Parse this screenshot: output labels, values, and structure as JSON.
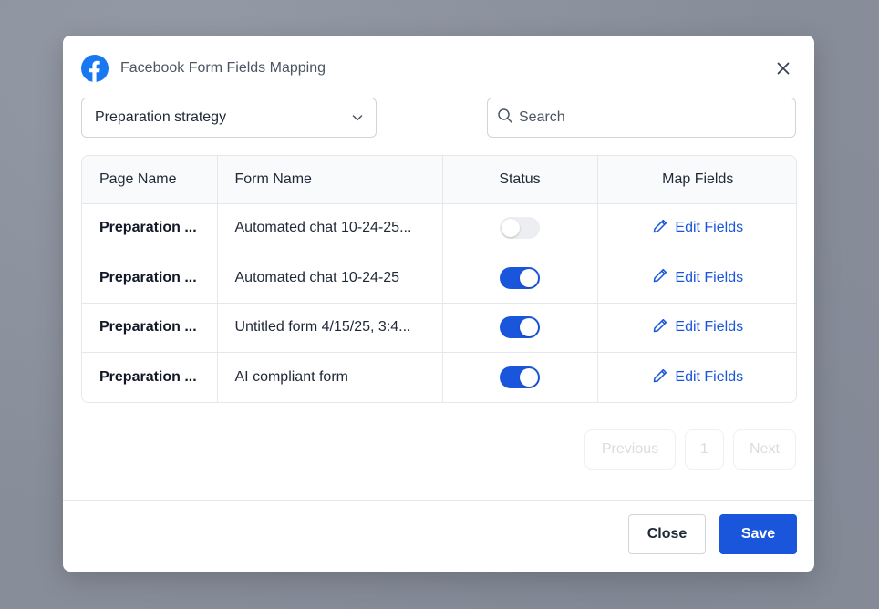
{
  "modal": {
    "title": "Facebook Form Fields Mapping",
    "icon": "facebook-icon",
    "close_icon": "close-icon"
  },
  "filter": {
    "page_select_value": "Preparation strategy",
    "search_placeholder": "Search"
  },
  "table": {
    "headers": {
      "page_name": "Page Name",
      "form_name": "Form Name",
      "status": "Status",
      "map_fields": "Map Fields"
    },
    "rows": [
      {
        "page_name": "Preparation ...",
        "form_name": "Automated chat 10-24-25...",
        "status": false,
        "action": "Edit Fields"
      },
      {
        "page_name": "Preparation ...",
        "form_name": "Automated chat 10-24-25",
        "status": true,
        "action": "Edit Fields"
      },
      {
        "page_name": "Preparation ...",
        "form_name": "Untitled form 4/15/25, 3:4...",
        "status": true,
        "action": "Edit Fields"
      },
      {
        "page_name": "Preparation ...",
        "form_name": "AI compliant form",
        "status": true,
        "action": "Edit Fields"
      }
    ]
  },
  "pagination": {
    "previous": "Previous",
    "current_page": "1",
    "next": "Next"
  },
  "footer": {
    "close_label": "Close",
    "save_label": "Save"
  },
  "colors": {
    "accent": "#1a56db",
    "facebook": "#1877f2"
  }
}
